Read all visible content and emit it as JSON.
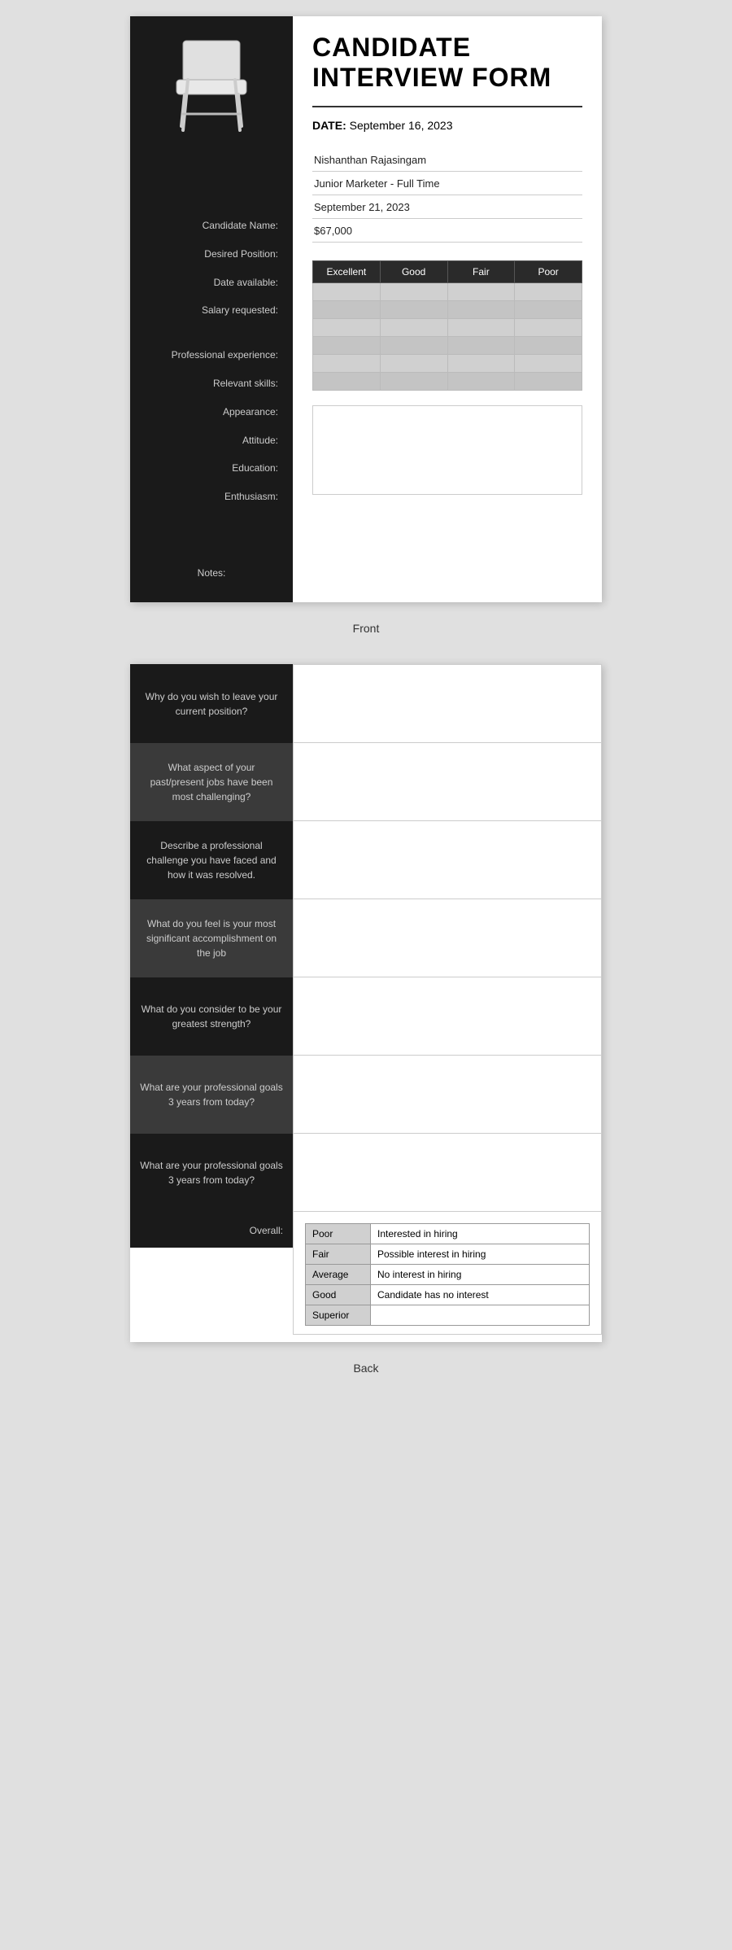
{
  "front": {
    "title_line1": "CANDIDATE",
    "title_line2": "INTERVIEW FORM",
    "date_label": "DATE:",
    "date_value": "September 16, 2023",
    "fields": [
      {
        "label": "Candidate Name:",
        "value": "Nishanthan Rajasingam"
      },
      {
        "label": "Desired Position:",
        "value": "Junior Marketer - Full Time"
      },
      {
        "label": "Date available:",
        "value": "September 21, 2023"
      },
      {
        "label": "Salary requested:",
        "value": "$67,000"
      }
    ],
    "rating_headers": [
      "Excellent",
      "Good",
      "Fair",
      "Poor"
    ],
    "rating_rows": [
      "Professional experience:",
      "Relevant skills:",
      "Appearance:",
      "Attitude:",
      "Education:",
      "Enthusiasm:"
    ],
    "notes_label": "Notes:",
    "card_label": "Front"
  },
  "back": {
    "questions": [
      {
        "id": "q1",
        "text": "Why do you wish to leave your current position?",
        "alt": false
      },
      {
        "id": "q2",
        "text": "What aspect of your past/present jobs have been most challenging?",
        "alt": true
      },
      {
        "id": "q3",
        "text": "Describe a professional challenge you have faced and how it was resolved.",
        "alt": false
      },
      {
        "id": "q4",
        "text": "What do you feel is your most significant accomplishment on the job",
        "alt": true
      },
      {
        "id": "q5",
        "text": "What do you consider to be your greatest strength?",
        "alt": false
      },
      {
        "id": "q6",
        "text": "What are your professional goals 3 years from today?",
        "alt": true
      },
      {
        "id": "q7",
        "text": "What are your professional goals 3 years from today?",
        "alt": false
      }
    ],
    "overall_label": "Overall:",
    "overall_rows": [
      {
        "rating": "Poor",
        "description": "Interested in hiring"
      },
      {
        "rating": "Fair",
        "description": "Possible interest in hiring"
      },
      {
        "rating": "Average",
        "description": "No interest in hiring"
      },
      {
        "rating": "Good",
        "description": "Candidate has no interest"
      },
      {
        "rating": "Superior",
        "description": ""
      }
    ],
    "card_label": "Back"
  }
}
